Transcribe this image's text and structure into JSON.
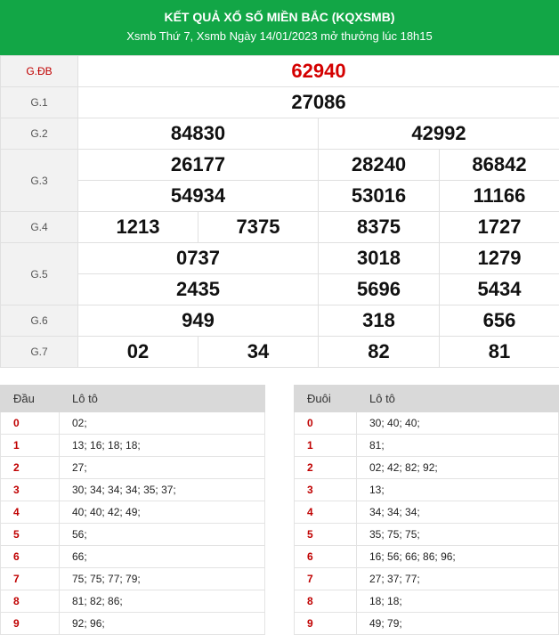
{
  "header": {
    "title": "KẾT QUẢ XỔ SỐ MIỀN BẮC (KQXSMB)",
    "subtitle": "Xsmb Thứ 7, Xsmb Ngày 14/01/2023 mở thưởng lúc 18h15"
  },
  "prizes": {
    "gdb": {
      "label": "G.ĐB",
      "numbers": [
        "62940"
      ]
    },
    "g1": {
      "label": "G.1",
      "numbers": [
        "27086"
      ]
    },
    "g2": {
      "label": "G.2",
      "numbers": [
        "84830",
        "42992"
      ]
    },
    "g3": {
      "label": "G.3",
      "numbers": [
        "26177",
        "28240",
        "86842",
        "54934",
        "53016",
        "11166"
      ]
    },
    "g4": {
      "label": "G.4",
      "numbers": [
        "1213",
        "7375",
        "8375",
        "1727"
      ]
    },
    "g5": {
      "label": "G.5",
      "numbers": [
        "0737",
        "3018",
        "1279",
        "2435",
        "5696",
        "5434"
      ]
    },
    "g6": {
      "label": "G.6",
      "numbers": [
        "949",
        "318",
        "656"
      ]
    },
    "g7": {
      "label": "G.7",
      "numbers": [
        "02",
        "34",
        "82",
        "81"
      ]
    }
  },
  "loto_dau": {
    "col1": "Đầu",
    "col2": "Lô tô",
    "rows": [
      {
        "key": "0",
        "value": "02;"
      },
      {
        "key": "1",
        "value": "13; 16; 18; 18;"
      },
      {
        "key": "2",
        "value": "27;"
      },
      {
        "key": "3",
        "value": "30; 34; 34; 34; 35; 37;"
      },
      {
        "key": "4",
        "value": "40; 40; 42; 49;"
      },
      {
        "key": "5",
        "value": "56;"
      },
      {
        "key": "6",
        "value": "66;"
      },
      {
        "key": "7",
        "value": "75; 75; 77; 79;"
      },
      {
        "key": "8",
        "value": "81; 82; 86;"
      },
      {
        "key": "9",
        "value": "92; 96;"
      }
    ]
  },
  "loto_duoi": {
    "col1": "Đuôi",
    "col2": "Lô tô",
    "rows": [
      {
        "key": "0",
        "value": "30; 40; 40;"
      },
      {
        "key": "1",
        "value": "81;"
      },
      {
        "key": "2",
        "value": "02; 42; 82; 92;"
      },
      {
        "key": "3",
        "value": "13;"
      },
      {
        "key": "4",
        "value": "34; 34; 34;"
      },
      {
        "key": "5",
        "value": "35; 75; 75;"
      },
      {
        "key": "6",
        "value": "16; 56; 66; 86; 96;"
      },
      {
        "key": "7",
        "value": "27; 37; 77;"
      },
      {
        "key": "8",
        "value": "18; 18;"
      },
      {
        "key": "9",
        "value": "49; 79;"
      }
    ]
  },
  "colors": {
    "header_bg": "#12a646",
    "special_prize": "#d40000",
    "loto_key": "#c00000"
  }
}
